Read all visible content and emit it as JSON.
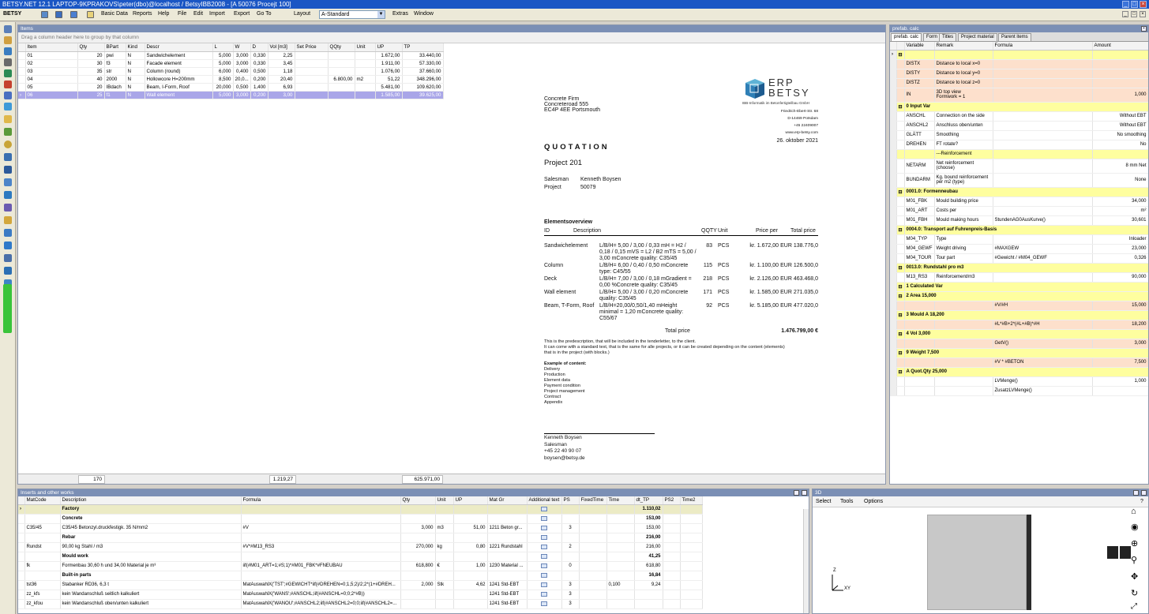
{
  "window": {
    "title": "BETSY.NET 12.1  LAPTOP-9KPRAKOVS\\peter(dbo)@localhost / BetsyIBB2008 - [A 50076 Procejt 100]"
  },
  "menu": {
    "app": "BETSY",
    "items": [
      "Basic Data",
      "Reports",
      "Help",
      "File",
      "Edit",
      "Import",
      "Export",
      "Go To",
      "Layout"
    ],
    "layout_value": "A-Standard",
    "items_right": [
      "Extras",
      "Window"
    ]
  },
  "items_panel": {
    "title": "Items",
    "group_hint": "Drag a column header here to group by that column",
    "columns": [
      "Item",
      "Qty",
      "BPart",
      "Kind",
      "Descr",
      "L",
      "W",
      "D",
      "Vol [m3]",
      "Set Price",
      "QQty",
      "Unit",
      "UP",
      "TP"
    ],
    "rows": [
      [
        "01",
        "20",
        "pwi",
        "N",
        "Sandwichelement",
        "5,000",
        "3,000",
        "0,330",
        "2,25",
        "",
        "",
        "",
        "1.672,00",
        "33.440,00"
      ],
      [
        "02",
        "30",
        "f3",
        "N",
        "Facade element",
        "5,000",
        "3,000",
        "0,330",
        "3,45",
        "",
        "",
        "",
        "1.911,00",
        "57.330,00"
      ],
      [
        "03",
        "35",
        "str",
        "N",
        "Column (round)",
        "6,000",
        "0,400",
        "0,500",
        "1,18",
        "",
        "",
        "",
        "1.076,00",
        "37.660,00"
      ],
      [
        "04",
        "40",
        "2000",
        "N",
        "Hollowcore H=200mm",
        "8,500",
        "20,0...",
        "0,200",
        "20,40",
        "",
        "6.800,00",
        "m2",
        "51,22",
        "348.296,00"
      ],
      [
        "05",
        "20",
        "IBdach",
        "N",
        "Beam, I-Form, Roof",
        "20,000",
        "0,500",
        "1,400",
        "6,93",
        "",
        "",
        "",
        "5.481,00",
        "109.620,00"
      ],
      [
        "06",
        "25",
        "f1",
        "N",
        "Wall element",
        "5,000",
        "3,000",
        "0,200",
        "3,00",
        "",
        "",
        "",
        "1.585,00",
        "39.625,00"
      ]
    ],
    "footer": {
      "qty": "170",
      "vol": "1.219,27",
      "tp": "625.971,00"
    }
  },
  "quotation": {
    "address": [
      "Concrete Firm",
      "Concreteroad 555",
      "EC4P 4EE Portsmouth"
    ],
    "logo": {
      "line1": "ERP",
      "line2": "BETSY",
      "tagline": "IBB-Informatik im Betonfertigteilbau GmbH"
    },
    "company": [
      "Friedrich-Ebert-Str. 68",
      "D-14469 Potsdam",
      "+45 22409007",
      "www.erp-betsy.com"
    ],
    "date": "26. oktober 2021",
    "heading": "QUOTATION",
    "project": "Project 201",
    "salesman_label": "Salesman",
    "salesman": "Kenneth Boysen",
    "project_label": "Project",
    "project_no": "50079",
    "overview_title": "Elementsoverview",
    "overview_cols": [
      "ID",
      "Description",
      "QQTY",
      "Unit",
      "Price per",
      "Total price"
    ],
    "overview_rows": [
      {
        "id": "Sandwichelement",
        "desc": [
          "L/B/H= 5,00 / 3,00 / 0,33 mH = H2 /",
          "0,18 / 0,15 mVS = L2 / B2 mTS = 5,00 /",
          "3,00 mConcrete quality: C35/45"
        ],
        "qty": "83",
        "unit": "PCS",
        "price": "kr. 1.672,00",
        "total": "EUR 138.776,0"
      },
      {
        "id": "Column",
        "desc": [
          "L/B/H= 6,00 / 0,40 / 0,50 mConcrete",
          "type: C45/55"
        ],
        "qty": "115",
        "unit": "PCS",
        "price": "kr. 1.100,00",
        "total": "EUR 126.500,0"
      },
      {
        "id": "Deck",
        "desc": [
          "L/B/H= 7,00 / 3,00 / 0,18 mGradient =",
          "0,00 %Concrete quality: C35/45"
        ],
        "qty": "218",
        "unit": "PCS",
        "price": "kr. 2.126,00",
        "total": "EUR 463.468,0"
      },
      {
        "id": "Wall element",
        "desc": [
          "L/B/H= 5,00 / 3,00 / 0,20 mConcrete",
          "quality: C35/45"
        ],
        "qty": "171",
        "unit": "PCS",
        "price": "kr. 1.585,00",
        "total": "EUR 271.035,0"
      },
      {
        "id": "Beam, T-Form, Roof",
        "desc": [
          "L/B/H=20,00/0,50/1,40  mHeight",
          "minimal = 1,20 mConcrete quality:",
          "C55/67"
        ],
        "qty": "92",
        "unit": "PCS",
        "price": "kr. 5.185,00",
        "total": "EUR 477.020,0"
      }
    ],
    "total_label": "Total price",
    "total_value": "1.476.799,00 €",
    "pre_text": [
      "This is the predescription, that will be included in the tenderletter, to the client.",
      "It can come with a standard text, that is the same for alle projects, or it can be created depending on the content (elements)",
      "that is in the project (with blocks.)"
    ],
    "example_title": "Example of content:",
    "example_items": [
      "Delivery",
      "Production",
      "Element data",
      "Payment condition",
      "Project management",
      "Contract",
      "Appendix"
    ],
    "signature": [
      "Kenneth Boysen",
      "Salesman",
      "+45 22 40 90 07",
      "boysen@betsy.de"
    ]
  },
  "prefab": {
    "title": "prefab. calc",
    "tabs": [
      "prefab. calc",
      "Form",
      "Titles",
      "Project material",
      "Parent items"
    ],
    "columns": [
      "Variable",
      "Remark",
      "Formula",
      "Amount"
    ],
    "rows": [
      {
        "t": "yel",
        "c": [
          "",
          "",
          "",
          ""
        ]
      },
      {
        "t": "pink",
        "c": [
          "DISTX",
          "Distance to local x=0",
          "",
          ""
        ]
      },
      {
        "t": "pink",
        "c": [
          "DISTY",
          "Distance to local y=0",
          "",
          ""
        ]
      },
      {
        "t": "pink",
        "c": [
          "DISTZ",
          "Distance to local z=0",
          "",
          ""
        ]
      },
      {
        "t": "pink",
        "c": [
          "IN",
          "3D top view\nFormwork = 1",
          "",
          "1,000"
        ]
      },
      {
        "t": "yel",
        "c": [
          "0   Input Var",
          "",
          "",
          ""
        ]
      },
      {
        "t": "wht",
        "c": [
          "ANSCHL",
          "Connection on the side",
          "",
          "Without EBT"
        ]
      },
      {
        "t": "wht",
        "c": [
          "ANSCHL2",
          "Anschluss oben/unten",
          "",
          "Without EBT"
        ]
      },
      {
        "t": "wht",
        "c": [
          "GLÄTT",
          "Smoothing",
          "",
          "No smoothing"
        ]
      },
      {
        "t": "wht",
        "c": [
          "DREHEN",
          "FT rotate?",
          "",
          "No"
        ]
      },
      {
        "t": "yel2",
        "c": [
          "",
          "---Reinforcement",
          "",
          ""
        ]
      },
      {
        "t": "wht",
        "c": [
          "NETARM",
          "Net reinforcement\n(choose)",
          "",
          "8 mm Net"
        ]
      },
      {
        "t": "wht",
        "c": [
          "BUNDARM",
          "Kg. bound reinforcement\nper m2 (type)",
          "",
          "None"
        ]
      },
      {
        "t": "yel",
        "c": [
          "0001.0: Formenneubau",
          "",
          "",
          ""
        ]
      },
      {
        "t": "wht",
        "c": [
          "M01_FBK",
          "Mould building price",
          "",
          "34,000"
        ]
      },
      {
        "t": "wht",
        "c": [
          "M01_ART",
          "Costs per",
          "",
          "m²"
        ]
      },
      {
        "t": "wht",
        "c": [
          "M01_FBH",
          "Mould making hours",
          "StundenAG0AusKurve()",
          "30,601"
        ]
      },
      {
        "t": "yel",
        "c": [
          "0004.0: Transport auf Fuhrenpreis-Basis",
          "",
          "",
          ""
        ]
      },
      {
        "t": "wht",
        "c": [
          "M04_TYP",
          "Type",
          "",
          "Inloader"
        ]
      },
      {
        "t": "wht",
        "c": [
          "M04_GEWF",
          "Weight driving",
          "#MAXGEW",
          "23,000"
        ]
      },
      {
        "t": "wht",
        "c": [
          "M04_TOUR",
          "Tour part",
          "#Gewicht / #M04_GEWF",
          "0,326"
        ]
      },
      {
        "t": "yel",
        "c": [
          "0013.0: Rundstahl pro m3",
          "",
          "",
          ""
        ]
      },
      {
        "t": "wht",
        "c": [
          "M13_RS3",
          "Reinforcement/m3",
          "",
          "90,000"
        ]
      },
      {
        "t": "yel",
        "c": [
          "1 Calculated Var",
          "",
          "",
          ""
        ]
      },
      {
        "t": "yel",
        "c": [
          "2 Area 15,000",
          "",
          "",
          ""
        ]
      },
      {
        "t": "pink",
        "c": [
          "",
          "",
          "#V/#H",
          "15,000"
        ]
      },
      {
        "t": "yel",
        "c": [
          "3 Mould A 18,200",
          "",
          "",
          ""
        ]
      },
      {
        "t": "pink",
        "c": [
          "",
          "",
          "#L*#B+2*(#L+#B)*#H",
          "18,200"
        ]
      },
      {
        "t": "yel",
        "c": [
          "4 Vol 3,000",
          "",
          "",
          ""
        ]
      },
      {
        "t": "pink",
        "c": [
          "",
          "",
          "GetV()",
          "3,000"
        ]
      },
      {
        "t": "yel",
        "c": [
          "9 Weight 7,500",
          "",
          "",
          ""
        ]
      },
      {
        "t": "pink",
        "c": [
          "",
          "",
          "#V * #BETON",
          "7,500"
        ]
      },
      {
        "t": "yel",
        "c": [
          "A Quot.Qty 25,000",
          "",
          "",
          ""
        ]
      },
      {
        "t": "wht",
        "c": [
          "",
          "",
          "LVMenge()",
          "1,000"
        ]
      },
      {
        "t": "wht",
        "c": [
          "",
          "",
          "ZusatzLVMenge()",
          ""
        ]
      }
    ]
  },
  "inserts": {
    "title": "Inserts and other works",
    "columns": [
      "MatCode",
      "Description",
      "Formula",
      "Qty",
      "Unit",
      "UP",
      "Mat Gr",
      "Additional text",
      "PS",
      "FixedTime",
      "Time",
      "dt_TP",
      "PS2",
      "Time2"
    ],
    "rows": [
      {
        "t": "fac",
        "c": [
          "",
          "Factory",
          "",
          "",
          "",
          "",
          "",
          "",
          "",
          "",
          "",
          "1.110,02",
          "",
          ""
        ]
      },
      {
        "t": "grp",
        "c": [
          "",
          "Concrete",
          "",
          "",
          "",
          "",
          "",
          "",
          "",
          "",
          "",
          "153,00",
          "",
          ""
        ]
      },
      {
        "t": "row",
        "c": [
          "C35/45",
          "C35/45 Betonzyl.druckfestigk.  35 N/mm2",
          "#V",
          "3,000",
          "m3",
          "51,00",
          "1211 Beton gr...",
          "",
          "3",
          "",
          "",
          "153,00",
          "",
          ""
        ]
      },
      {
        "t": "grp",
        "c": [
          "",
          "Rebar",
          "",
          "",
          "",
          "",
          "",
          "",
          "",
          "",
          "",
          "216,00",
          "",
          ""
        ]
      },
      {
        "t": "row",
        "c": [
          "Rundst",
          "90,00 kg Stahl / m3",
          "#V*#M13_RS3",
          "270,000",
          "kg",
          "0,80",
          "1221 Rundstahl",
          "",
          "2",
          "",
          "",
          "216,00",
          "",
          ""
        ]
      },
      {
        "t": "grp",
        "c": [
          "",
          "Mould work",
          "",
          "",
          "",
          "",
          "",
          "",
          "",
          "",
          "",
          "41,25",
          "",
          ""
        ]
      },
      {
        "t": "row",
        "c": [
          "fk",
          "Formenbau 30,60 h und 34,00 Material je m³",
          "iif(#M01_ART=1;#S;1)*#M01_FBK*#FNEUBAU",
          "618,800",
          "€",
          "1,00",
          "1230 Material ...",
          "",
          "0",
          "",
          "",
          "618,80",
          "",
          ""
        ]
      },
      {
        "t": "grp",
        "c": [
          "",
          "Built-in parts",
          "",
          "",
          "",
          "",
          "",
          "",
          "",
          "",
          "",
          "16,84",
          "",
          ""
        ]
      },
      {
        "t": "row",
        "c": [
          "tst36",
          "Stabanker RD36, 6,3 t",
          "MatAuswahlX('TST';#GEWICHT*iif(#DREHEN=0;1,5;2)/2;2*(1+#DREH...",
          "2,000",
          "Stk",
          "4,62",
          "1241 Std-EBT",
          "",
          "3",
          "",
          "0,100",
          "9,24",
          "",
          ""
        ]
      },
      {
        "t": "row",
        "c": [
          "zz_kfs",
          "kein Wandanschluß seitlich kalkuliert",
          "MatAuswahlX('WANS';#ANSCHL;iif(#ANSCHL=0;0;2*#B))",
          "",
          "",
          "",
          "1241 Std-EBT",
          "",
          "3",
          "",
          "",
          "",
          "",
          ""
        ]
      },
      {
        "t": "row",
        "c": [
          "zz_kfou",
          "kein Wandanschluß oben/unten kalkuliert",
          "MatAuswahlX('WANOU';#ANSCHL2;iif(#ANSCHL2=0;0;iif(#ANSCHL2=...",
          "",
          "",
          "",
          "1241 Std-EBT",
          "",
          "3",
          "",
          "",
          "",
          "",
          ""
        ]
      }
    ]
  },
  "view3d": {
    "title": "3D",
    "menu": [
      "Select",
      "Tools",
      "Options"
    ],
    "axis_z": "Z",
    "axis_xy": "XY"
  }
}
